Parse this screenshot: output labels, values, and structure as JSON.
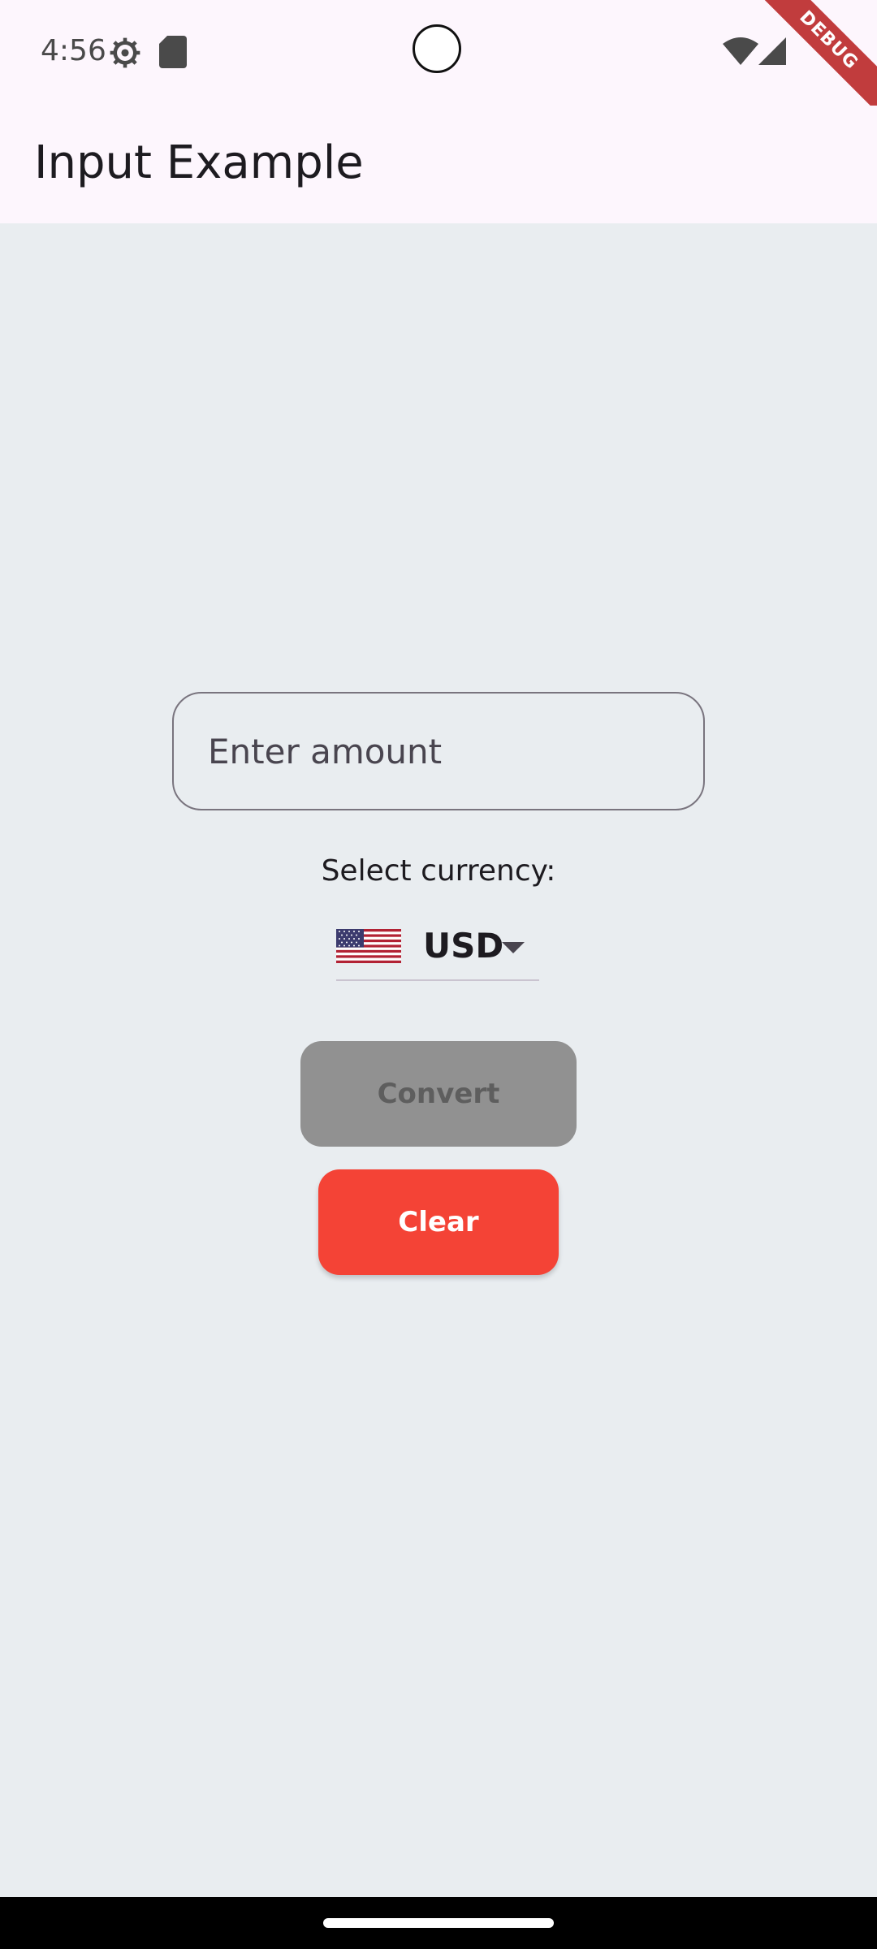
{
  "status_bar": {
    "time": "4:56",
    "icons": [
      "settings-gear-icon",
      "sd-card-icon",
      "wifi-icon",
      "cell-signal-icon"
    ]
  },
  "debug_banner": "DEBUG",
  "app_bar": {
    "title": "Input Example"
  },
  "amount_input": {
    "value": "",
    "placeholder": "Enter amount"
  },
  "currency": {
    "label": "Select currency:",
    "selected": "USD",
    "flag_icon": "us-flag-icon"
  },
  "buttons": {
    "convert_label": "Convert",
    "clear_label": "Clear"
  },
  "colors": {
    "app_bar_bg": "#FDF6FD",
    "page_bg": "#E9EDF0",
    "convert_disabled": "#919191",
    "clear_red": "#F44336"
  }
}
